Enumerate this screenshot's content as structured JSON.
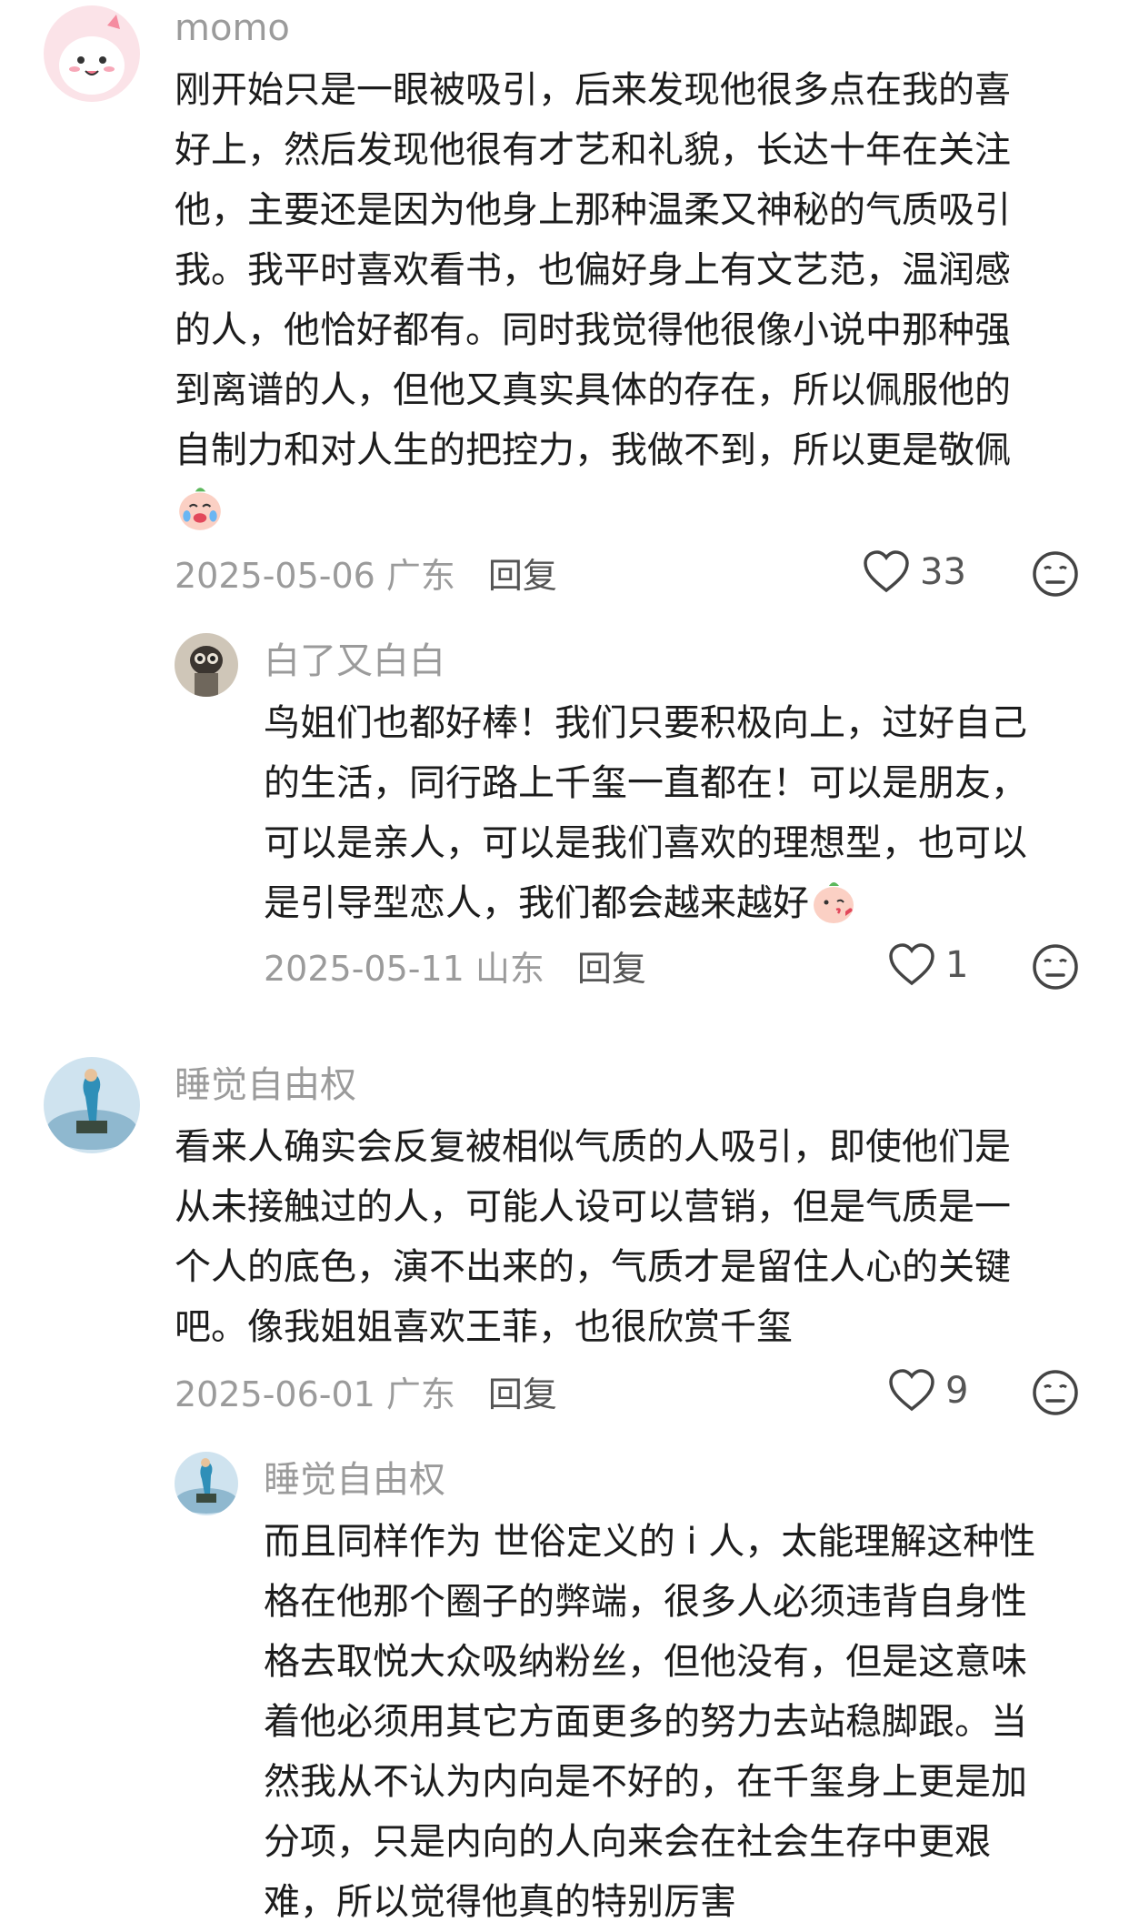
{
  "comments": [
    {
      "user": "momo",
      "lines": [
        "刚开始只是一眼被吸引，后来发现他很多点在我的喜",
        "好上，然后发现他很有才艺和礼貌，长达十年在关注",
        "他，主要还是因为他身上那种温柔又神秘的气质吸引",
        "我。我平时喜欢看书，也偏好身上有文艺范，温润感",
        "的人，他恰好都有。同时我觉得他很像小说中那种强",
        "到离谱的人，但他又真实具体的存在，所以佩服他的",
        "自制力和对人生的把控力，我做不到，所以更是敬佩"
      ],
      "emoji": "crying-face-emoji",
      "date_location": "2025-05-06 广东",
      "reply_label": "回复",
      "likes": "33"
    },
    {
      "user": "白了又白白",
      "lines": [
        "鸟姐们也都好棒！我们只要积极向上，过好自己",
        "的生活，同行路上千玺一直都在！可以是朋友，",
        "可以是亲人，可以是我们喜欢的理想型，也可以",
        "是引导型恋人，我们都会越来越好"
      ],
      "emoji": "kissing-face-emoji",
      "date_location": "2025-05-11 山东",
      "reply_label": "回复",
      "likes": "1"
    },
    {
      "user": "睡觉自由权",
      "lines": [
        "看来人确实会反复被相似气质的人吸引，即使他们是",
        "从未接触过的人，可能人设可以营销，但是气质是一",
        "个人的底色，演不出来的，气质才是留住人心的关键",
        "吧。像我姐姐喜欢王菲，也很欣赏千玺"
      ],
      "date_location": "2025-06-01 广东",
      "reply_label": "回复",
      "likes": "9"
    },
    {
      "user": "睡觉自由权",
      "lines": [
        "而且同样作为 世俗定义的 i 人，太能理解这种性",
        "格在他那个圈子的弊端，很多人必须违背自身性",
        "格去取悦大众吸纳粉丝，但他没有，但是这意味",
        "着他必须用其它方面更多的努力去站稳脚跟。当",
        "然我从不认为内向是不好的，在千玺身上更是加",
        "分项，只是内向的人向来会在社会生存中更艰",
        "难，所以觉得他真的特别厉害"
      ]
    }
  ],
  "icons": {
    "like": "heart-outline-icon",
    "dislike": "neutral-face-icon"
  },
  "colors": {
    "name": "#9b9b9b",
    "text": "#1c1c1c",
    "meta": "#9b9b9b",
    "reply": "#555555"
  }
}
